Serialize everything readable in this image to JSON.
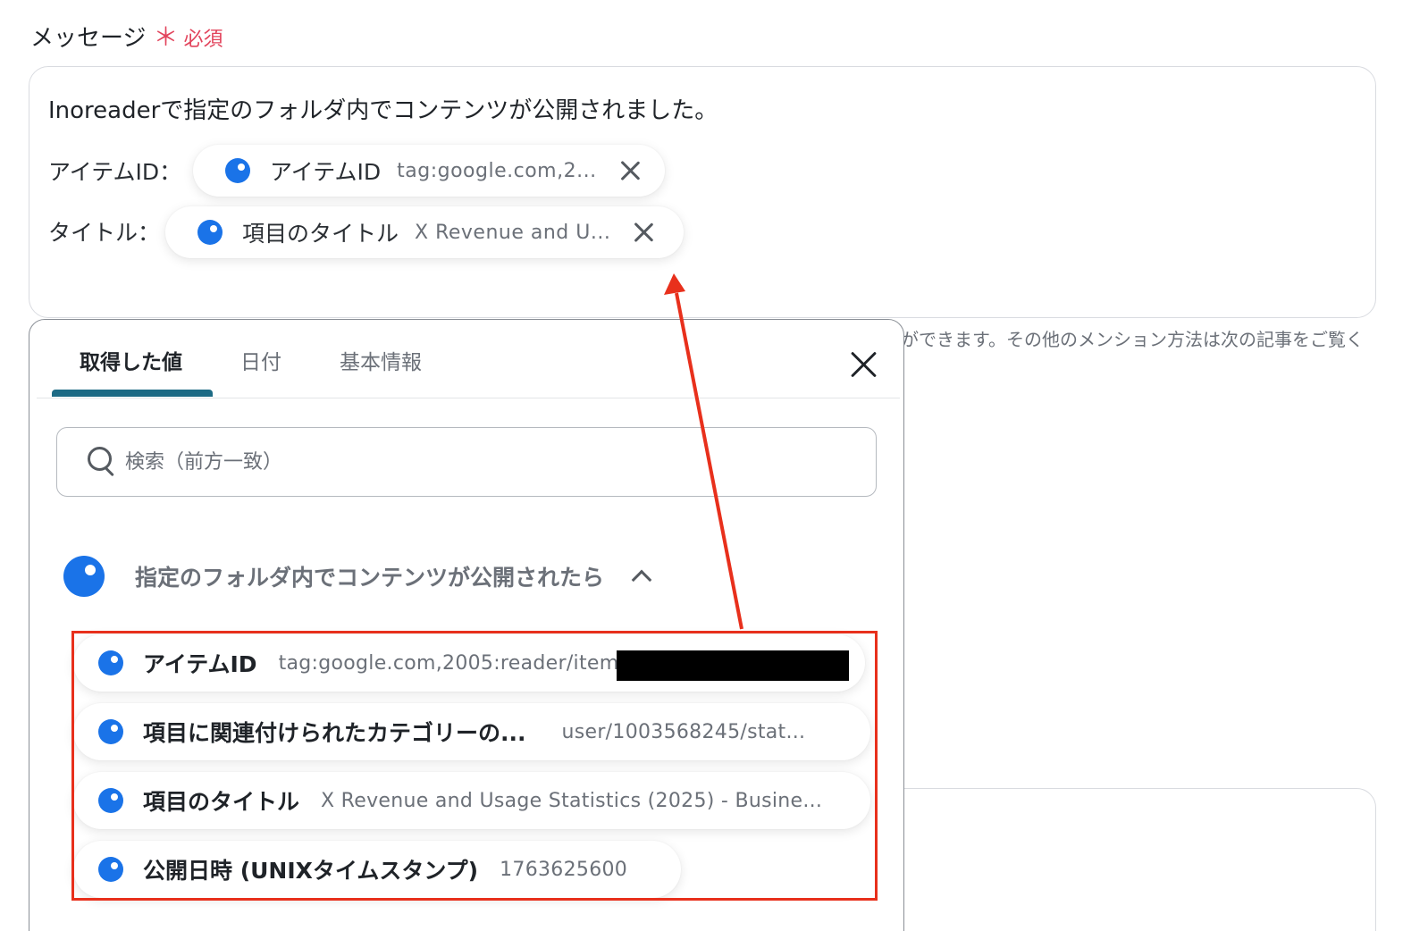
{
  "field": {
    "label": "メッセージ",
    "required_mark": "＊",
    "required_text": "必須"
  },
  "message": {
    "line1": "Inoreaderで指定のフォルダ内でコンテンツが公開されました。",
    "line2_prefix": "アイテムID：",
    "line3_prefix": "タイトル：",
    "pill_item_id": {
      "name": "アイテムID",
      "value": "tag:google.com,2..."
    },
    "pill_title": {
      "name": "項目のタイトル",
      "value": "X Revenue and U..."
    }
  },
  "hint": "ができます。その他のメンション方法は次の記事をご覧く",
  "popup": {
    "tabs": [
      {
        "label": "取得した値",
        "active": true
      },
      {
        "label": "日付",
        "active": false
      },
      {
        "label": "基本情報",
        "active": false
      }
    ],
    "search_placeholder": "検索（前方一致）",
    "group_title": "指定のフォルダ内でコンテンツが公開されたら",
    "items": [
      {
        "name": "アイテムID",
        "value": "tag:google.com,2005:reader/item/"
      },
      {
        "name": "項目に関連付けられたカテゴリーの...",
        "value": "user/1003568245/stat..."
      },
      {
        "name": "項目のタイトル",
        "value": "X Revenue and Usage Statistics (2025) - Busine..."
      },
      {
        "name": "公開日時 (UNIXタイムスタンプ)",
        "value": "1763625600"
      }
    ]
  },
  "colors": {
    "accent_blue": "#1a73e8",
    "required_red": "#e2445c",
    "annotation_red": "#e8301c",
    "tab_underline": "#1d6b85"
  },
  "icons": [
    "search-icon",
    "close-icon",
    "chevron-up-icon",
    "token-dot-icon"
  ]
}
